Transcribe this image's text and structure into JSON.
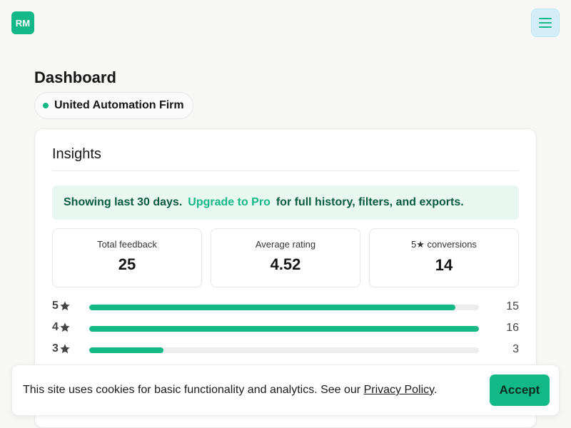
{
  "brand": {
    "logo_text": "RM",
    "accent": "#12b886"
  },
  "header": {
    "menu_icon": "hamburger-icon"
  },
  "page": {
    "title": "Dashboard",
    "org_name": "United Automation Firm"
  },
  "insights": {
    "title": "Insights",
    "banner": {
      "prefix": "Showing last 30 days.",
      "link": "Upgrade to Pro",
      "suffix": "for full history, filters, and exports."
    },
    "stats": [
      {
        "label": "Total feedback",
        "value": "25"
      },
      {
        "label": "Average rating",
        "value": "4.52"
      },
      {
        "label": "5★ conversions",
        "value": "14"
      }
    ],
    "distribution": [
      {
        "stars": "5",
        "count": "15",
        "fraction": 0.94
      },
      {
        "stars": "4",
        "count": "16",
        "fraction": 1.0
      },
      {
        "stars": "3",
        "count": "3",
        "fraction": 0.19
      }
    ]
  },
  "cookie": {
    "text": "This site uses cookies for basic functionality and analytics. See our ",
    "link": "Privacy Policy",
    "end": ".",
    "accept_label": "Accept"
  }
}
